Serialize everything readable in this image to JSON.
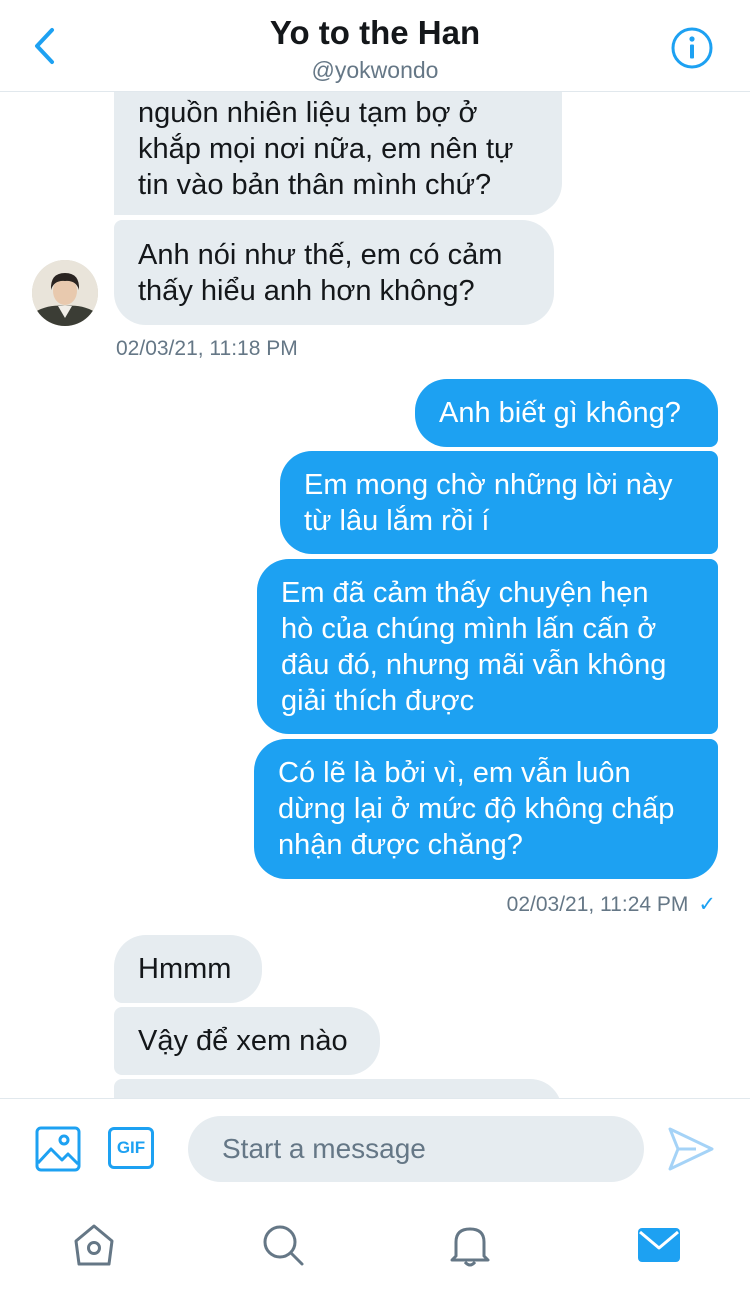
{
  "header": {
    "title": "Yo to the Han",
    "handle": "@yokwondo",
    "back_icon": "chevron-left-icon",
    "info_icon": "info-icon"
  },
  "messages": [
    {
      "side": "received",
      "lines": [
        "nguồn nhiên liệu tạm bợ ở",
        "khắp mọi nơi nữa, em nên tự",
        "tin vào bản thân mình chứ?"
      ]
    },
    {
      "side": "received",
      "lines": [
        "Anh nói như thế, em có cảm",
        "thấy hiểu anh hơn không?"
      ]
    },
    {
      "timestamp": "02/03/21, 11:18 PM"
    },
    {
      "side": "sent",
      "lines": [
        "Anh biết gì không?"
      ]
    },
    {
      "side": "sent",
      "lines": [
        "Em mong chờ những lời này",
        "từ lâu lắm rồi í"
      ]
    },
    {
      "side": "sent",
      "lines": [
        "Em đã cảm thấy chuyện hẹn",
        "hò của chúng mình lấn cấn ở",
        "đâu đó, nhưng mãi vẫn không",
        "giải thích được"
      ]
    },
    {
      "side": "sent",
      "lines": [
        "Có lẽ là bởi vì, em vẫn luôn",
        "dừng lại ở mức độ không chấp",
        "nhận được chăng?"
      ]
    },
    {
      "timestamp": "02/03/21, 11:24 PM",
      "read_receipt": "✓"
    },
    {
      "side": "received",
      "lines": [
        "Hmmm"
      ]
    },
    {
      "side": "received",
      "lines": [
        "Vậy để xem nào"
      ]
    }
  ],
  "composer": {
    "placeholder": "Start a message",
    "gif_label": "GIF",
    "image_icon": "image-icon",
    "send_icon": "send-icon"
  },
  "tabs": [
    {
      "name": "home",
      "icon": "home-icon"
    },
    {
      "name": "search",
      "icon": "search-icon"
    },
    {
      "name": "notifications",
      "icon": "bell-icon"
    },
    {
      "name": "messages",
      "icon": "mail-icon",
      "active": true
    }
  ],
  "colors": {
    "accent": "#1da1f2",
    "received_bubble": "#e6ecf0",
    "secondary_text": "#657786",
    "icon_gray": "#657786"
  }
}
